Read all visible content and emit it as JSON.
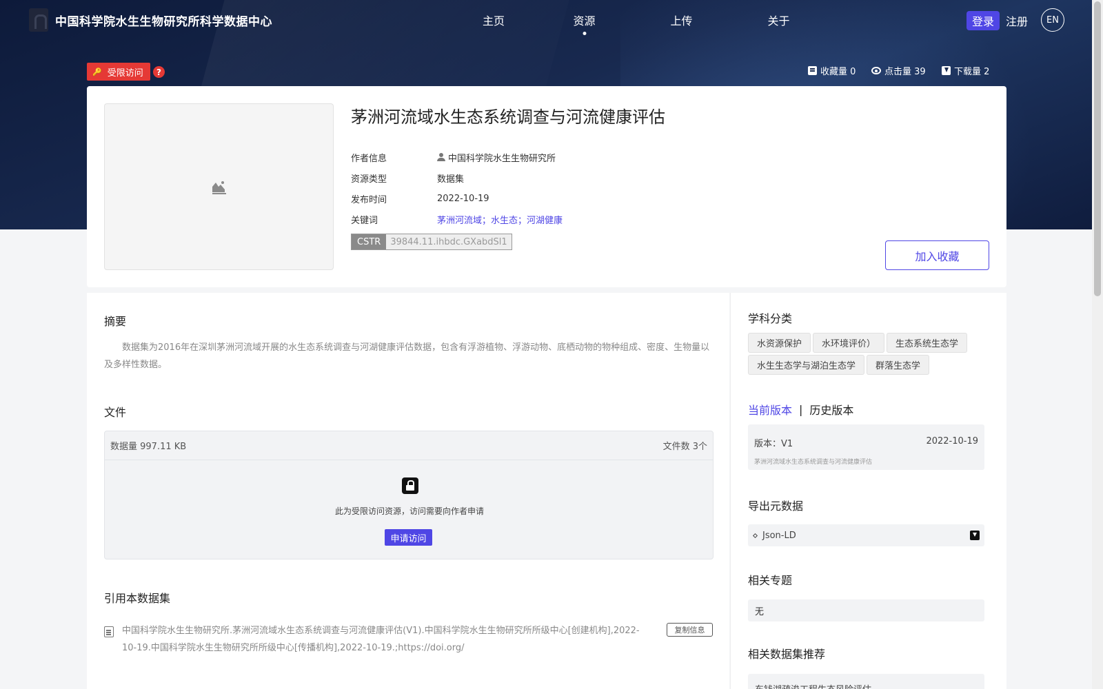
{
  "site": {
    "title": "中国科学院水生生物研究所科学数据中心"
  },
  "nav": {
    "items": [
      "主页",
      "资源",
      "上传",
      "关于"
    ],
    "active": "资源",
    "login": "登录",
    "register": "注册",
    "lang": "EN"
  },
  "access": {
    "label": "受限访问",
    "help": "?"
  },
  "stats": {
    "favorites": "收藏量 0",
    "views": "点击量 39",
    "downloads": "下载量 2"
  },
  "resource": {
    "title": "茅洲河流域水生态系统调查与河流健康评估",
    "meta": [
      {
        "label": "作者信息",
        "value": "中国科学院水生生物研究所"
      },
      {
        "label": "资源类型",
        "value": "数据集"
      },
      {
        "label": "发布时间",
        "value": "2022-10-19"
      },
      {
        "label": "关键词",
        "value": "茅洲河流域；水生态；河湖健康"
      }
    ],
    "cstr_key": "CSTR",
    "cstr_value": "39844.11.ihbdc.GXabdSl1",
    "favorite_button": "加入收藏"
  },
  "abstract": {
    "title": "摘要",
    "text": "数据集为2016年在深圳茅洲河流域开展的水生态系统调查与河湖健康评估数据，包含有浮游植物、浮游动物、底栖动物的物种组成、密度、生物量以及多样性数据。"
  },
  "files": {
    "title": "文件",
    "size": "数据量 997.11 KB",
    "count": "文件数 3个",
    "restricted_message": "此为受限访问资源，访问需要向作者申请",
    "apply_button": "申请访问"
  },
  "citation": {
    "title": "引用本数据集",
    "text": "中国科学院水生生物研究所.茅洲河流域水生态系统调查与河流健康评估(V1).中国科学院水生生物研究所所级中心[创建机构],2022-10-19.中国科学院水生生物研究所所级中心[传播机构],2022-10-19.;https://doi.org/",
    "copy_button": "复制信息"
  },
  "sidebar": {
    "discipline_title": "学科分类",
    "disciplines": [
      "水资源保护",
      "水环境评价）",
      "生态系统生态学",
      "水生生态学与湖泊生态学",
      "群落生态学"
    ],
    "version_tabs": [
      "当前版本",
      "历史版本"
    ],
    "version": {
      "name": "版本：V1",
      "date": "2022-10-19",
      "desc": "茅洲河流域水生态系统调查与河流健康评估"
    },
    "export_title": "导出元数据",
    "export_format": "Json-LD",
    "topics_title": "相关专题",
    "topics_value": "无",
    "recommend_title": "相关数据集推荐",
    "recommend_first": "东钱湖疏浚工程生态风险评估"
  }
}
